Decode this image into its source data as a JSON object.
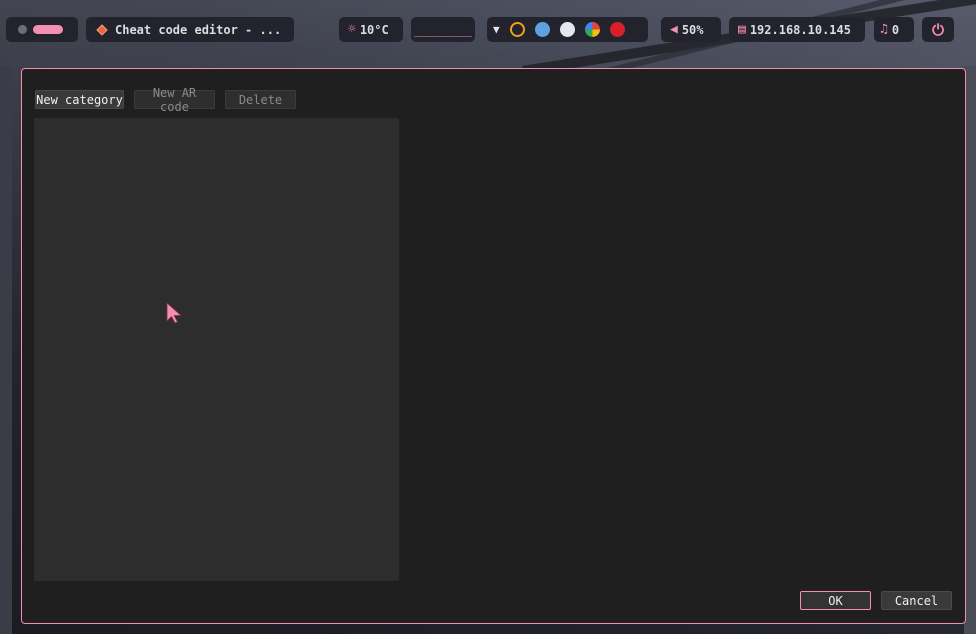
{
  "topbar": {
    "window_title": "Cheat code editor - ...",
    "weather": "10°C",
    "media": "________",
    "tray_toggle": "▼",
    "volume": "50%",
    "ip_address": "192.168.10.145",
    "notifications": "0"
  },
  "icons": {
    "weather": "sun-icon",
    "volume": "speaker-icon",
    "network": "ethernet-icon",
    "notifications": "bell-icon",
    "power": "power-icon"
  },
  "dialog": {
    "toolbar": {
      "new_category": "New category",
      "new_ar_code": "New AR code",
      "delete": "Delete"
    },
    "buttons": {
      "ok": "OK",
      "cancel": "Cancel"
    }
  },
  "colors": {
    "accent": "#f48fb1",
    "dialog_bg": "#1f1f1f",
    "tree_bg": "#2d2d2d"
  }
}
